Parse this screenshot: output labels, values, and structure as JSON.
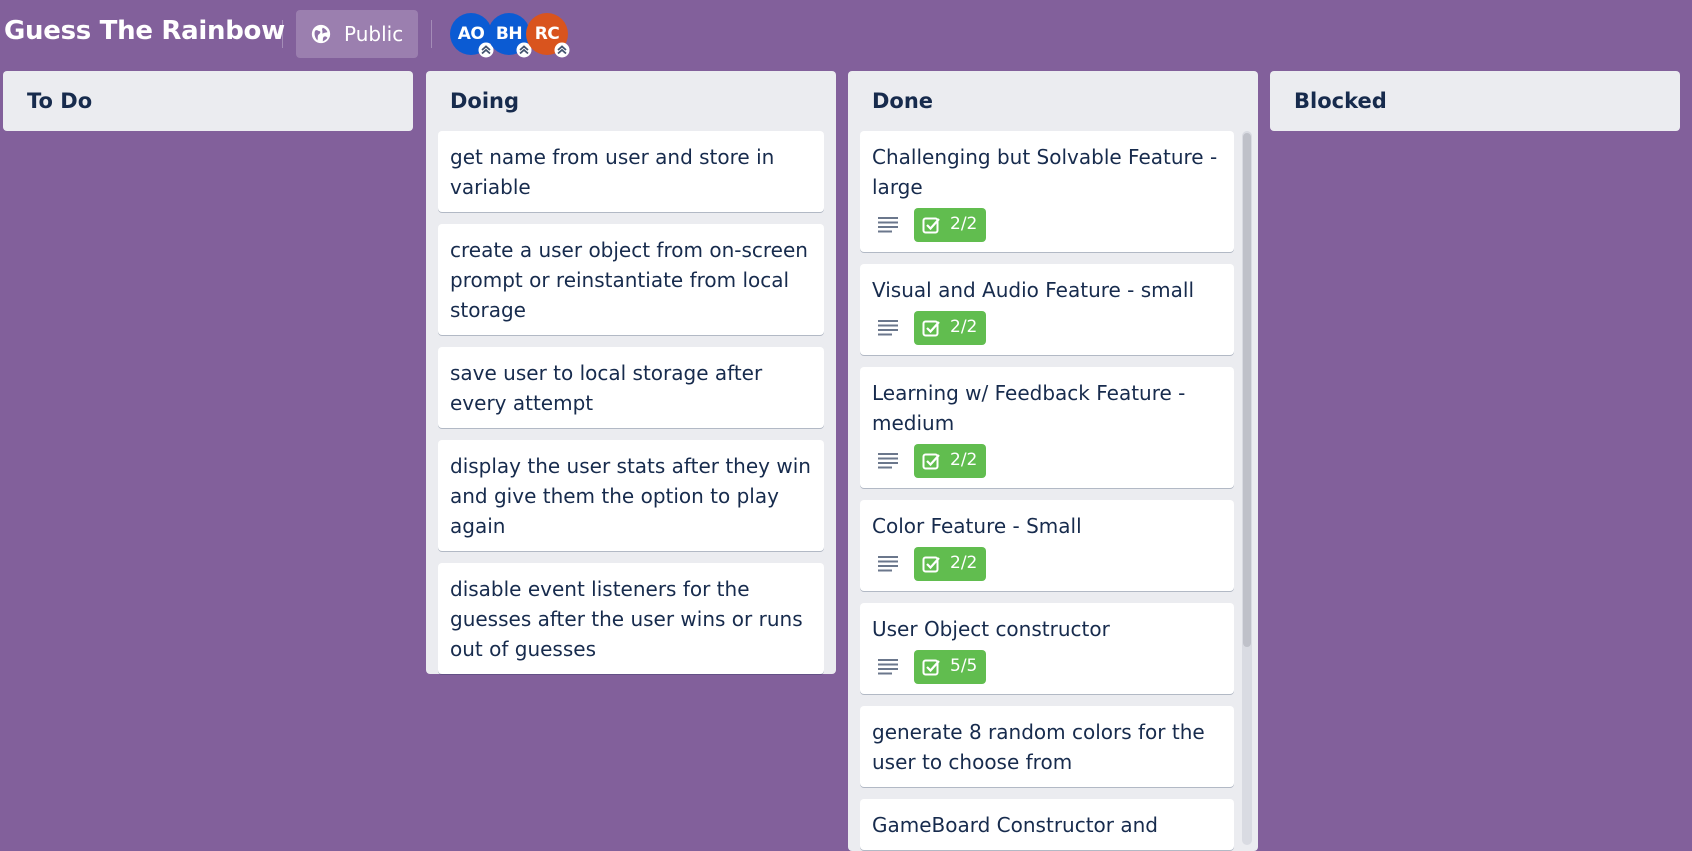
{
  "board": {
    "title": "Guess The Rainbow",
    "visibility_label": "Public",
    "members": [
      {
        "initials": "AO",
        "color": "#0b5bd3"
      },
      {
        "initials": "BH",
        "color": "#0b5bd3"
      },
      {
        "initials": "RC",
        "color": "#d9541e"
      }
    ]
  },
  "lists": {
    "todo": {
      "title": "To Do"
    },
    "doing": {
      "title": "Doing",
      "cards": [
        "get name from user and store in variable",
        "create a user object from on-screen prompt or reinstantiate from local storage",
        "save user to local storage after every attempt",
        "display the user stats after they win and give them the option to play again",
        "disable event listeners for the guesses after the user wins or runs out of guesses"
      ]
    },
    "done": {
      "title": "Done",
      "cards": [
        {
          "title": "Challenging but Solvable Feature - large",
          "checklist": "2/2"
        },
        {
          "title": "Visual and Audio Feature - small",
          "checklist": "2/2"
        },
        {
          "title": "Learning w/ Feedback Feature - medium",
          "checklist": "2/2"
        },
        {
          "title": "Color Feature - Small",
          "checklist": "2/2"
        },
        {
          "title": "User Object constructor",
          "checklist": "5/5"
        },
        {
          "title": "generate 8 random colors for the user to choose from"
        },
        {
          "title": "GameBoard Constructor and"
        }
      ]
    },
    "blocked": {
      "title": "Blocked"
    }
  },
  "colors": {
    "background": "#82609b",
    "list_bg": "#ebecf0",
    "checklist_complete": "#61bd4f",
    "text": "#172b4d"
  },
  "icons": [
    "globe-icon",
    "description-icon",
    "checklist-icon"
  ]
}
